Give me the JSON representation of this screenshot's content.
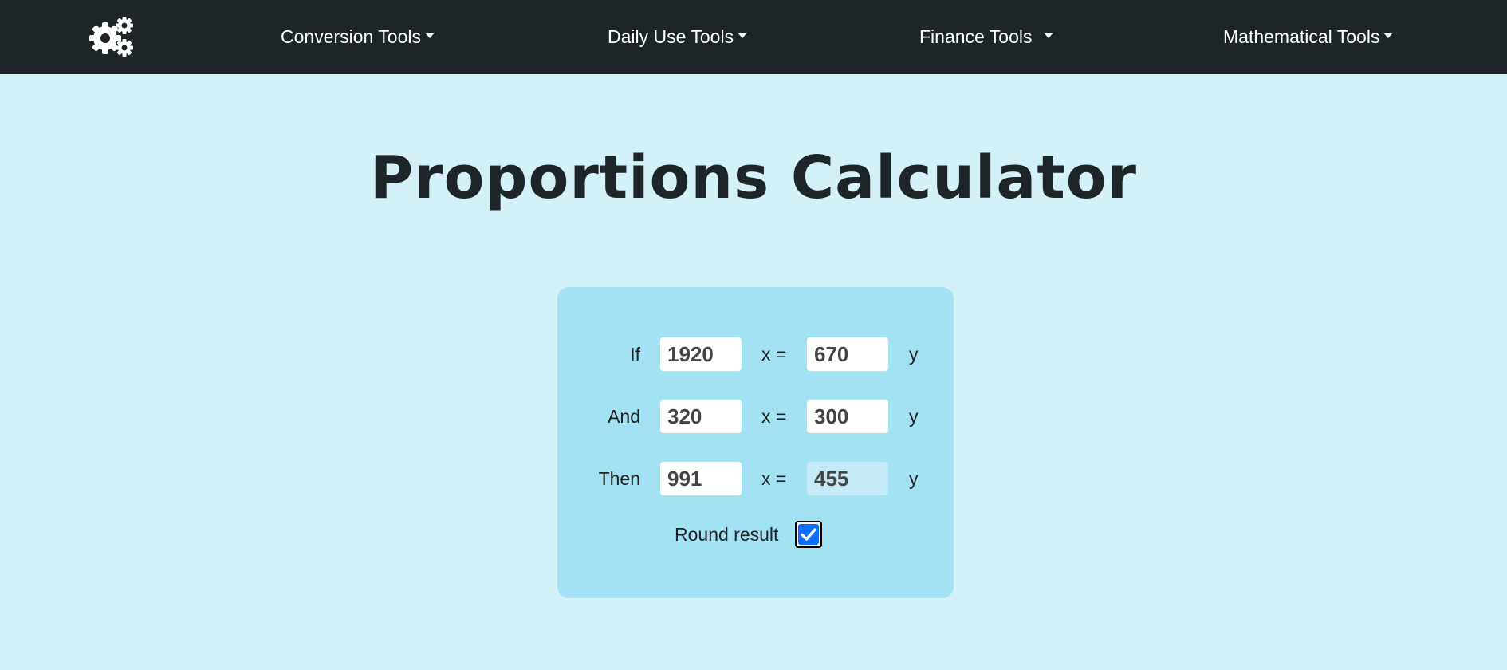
{
  "nav": {
    "items": [
      {
        "label": "Conversion Tools"
      },
      {
        "label": "Daily Use Tools"
      },
      {
        "label": "Finance Tools"
      },
      {
        "label": "Mathematical Tools"
      }
    ]
  },
  "page": {
    "title": "Proportions Calculator"
  },
  "calculator": {
    "rows": [
      {
        "label": "If",
        "x_value": "1920",
        "y_value": "670"
      },
      {
        "label": "And",
        "x_value": "320",
        "y_value": "300"
      },
      {
        "label": "Then",
        "x_value": "991",
        "y_value": "455"
      }
    ],
    "x_text": "x =",
    "y_text": "y",
    "round_label": "Round result",
    "round_checked": true
  },
  "icons": {
    "logo": "gears-icon",
    "checkbox_mark": "checkmark-icon"
  },
  "colors": {
    "navbar": "#1e2528",
    "page_background": "#d4f1f8",
    "panel_background": "#a3e2f2",
    "checkbox_accent": "#0d6efd"
  }
}
